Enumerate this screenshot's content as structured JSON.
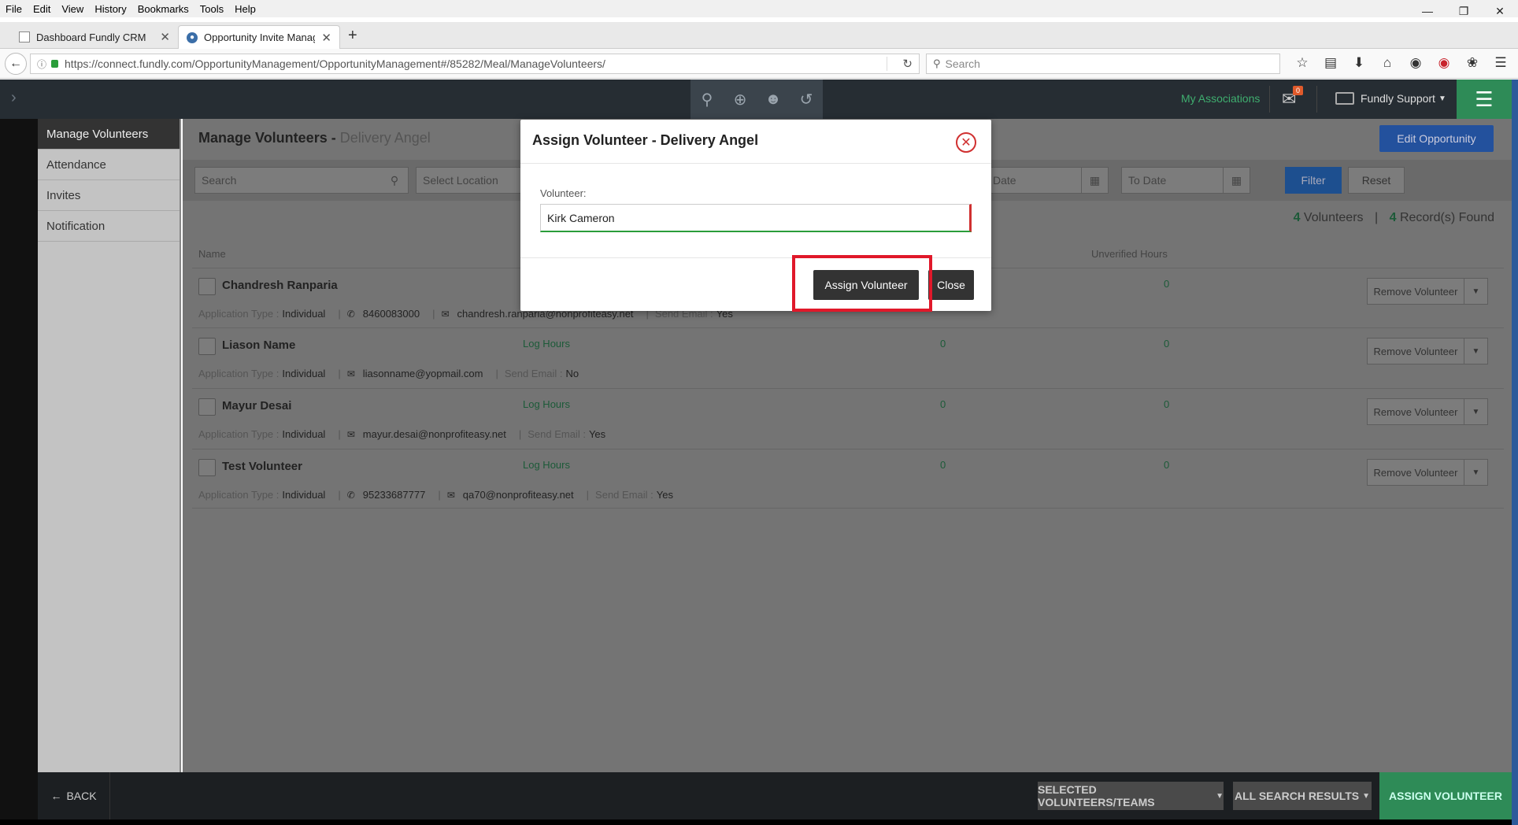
{
  "browser": {
    "menu": [
      "File",
      "Edit",
      "View",
      "History",
      "Bookmarks",
      "Tools",
      "Help"
    ],
    "tabs": [
      {
        "title": "Dashboard Fundly CRM"
      },
      {
        "title": "Opportunity Invite Managem"
      }
    ],
    "url": "https://connect.fundly.com/OpportunityManagement/OpportunityManagement#/85282/Meal/ManageVolunteers/",
    "search_placeholder": "Search"
  },
  "header": {
    "my_associations": "My Associations",
    "mail_badge": "0",
    "user_menu": "Fundly Support"
  },
  "sidebar": {
    "items": [
      {
        "label": "Manage Volunteers"
      },
      {
        "label": "Attendance"
      },
      {
        "label": "Invites"
      },
      {
        "label": "Notification"
      }
    ]
  },
  "main": {
    "title": "Manage Volunteers - ",
    "subtitle": "Delivery Angel",
    "edit_button": "Edit Opportunity",
    "filters": {
      "search_placeholder": "Search",
      "location_placeholder": "Select Location",
      "from_date_placeholder": "Date",
      "to_date_placeholder": "To Date",
      "filter_button": "Filter",
      "reset_button": "Reset"
    },
    "counts": {
      "volunteers_num": "4",
      "volunteers_label": "Volunteers",
      "records_num": "4",
      "records_label": "Record(s) Found"
    },
    "columns": {
      "name": "Name",
      "unverified_hours": "Unverified Hours"
    },
    "labels": {
      "application_type": "Application Type :",
      "send_email": "Send Email :",
      "log_hours": "Log Hours",
      "remove": "Remove Volunteer"
    },
    "rows": [
      {
        "name": "Chandresh Ranparia",
        "app_type": "Individual",
        "phone": "8460083000",
        "email": "chandresh.ranparia@nonprofiteasy.net",
        "send_email": "Yes",
        "log_hours": "",
        "verified": "",
        "unverified": "0"
      },
      {
        "name": "Liason Name",
        "app_type": "Individual",
        "phone": "",
        "email": "liasonname@yopmail.com",
        "send_email": "No",
        "log_hours": "Log Hours",
        "verified": "0",
        "unverified": "0"
      },
      {
        "name": "Mayur Desai",
        "app_type": "Individual",
        "phone": "",
        "email": "mayur.desai@nonprofiteasy.net",
        "send_email": "Yes",
        "log_hours": "Log Hours",
        "verified": "0",
        "unverified": "0"
      },
      {
        "name": "Test Volunteer",
        "app_type": "Individual",
        "phone": "95233687777",
        "email": "qa70@nonprofiteasy.net",
        "send_email": "Yes",
        "log_hours": "Log Hours",
        "verified": "0",
        "unverified": "0"
      }
    ]
  },
  "bottombar": {
    "back": "BACK",
    "selected": "SELECTED VOLUNTEERS/TEAMS",
    "all_results": "ALL SEARCH RESULTS",
    "assign": "ASSIGN VOLUNTEER"
  },
  "modal": {
    "title": "Assign Volunteer - Delivery Angel",
    "field_label": "Volunteer:",
    "field_value": "Kirk Cameron",
    "assign_button": "Assign Volunteer",
    "close_button": "Close"
  }
}
